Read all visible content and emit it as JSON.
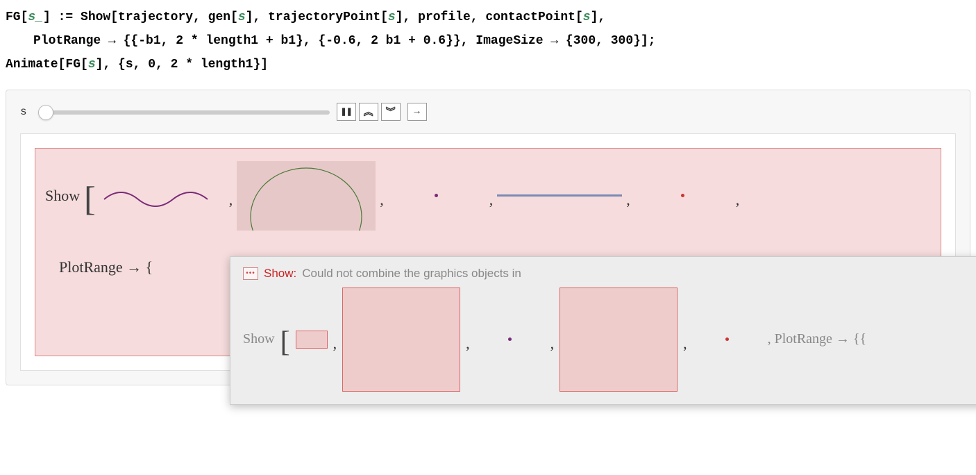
{
  "code": {
    "line1_a": "FG[",
    "line1_pat": "s_",
    "line1_b": "] := Show[trajectory, gen[",
    "line1_s1": "s",
    "line1_c": "], trajectoryPoint[",
    "line1_s2": "s",
    "line1_d": "], profile, contactPoint[",
    "line1_s3": "s",
    "line1_e": "],",
    "line2": "PlotRange → {{-b1, 2 * length1 + b1}, {-0.6, 2 b1 + 0.6}}, ImageSize → {300, 300}];",
    "line3_a": "Animate[FG[",
    "line3_s": "s",
    "line3_b": "], {s, 0, 2 * length1}]"
  },
  "animate": {
    "var": "s",
    "buttons": {
      "pause": "❚❚",
      "faster": "︽",
      "slower": "︾",
      "forward": "→"
    }
  },
  "output": {
    "show": "Show",
    "plotrange": "PlotRange → {"
  },
  "tooltip": {
    "errname": "Show:",
    "errmsg": "Could not combine the graphics objects in",
    "show": "Show",
    "trail": ", PlotRange → {{"
  }
}
